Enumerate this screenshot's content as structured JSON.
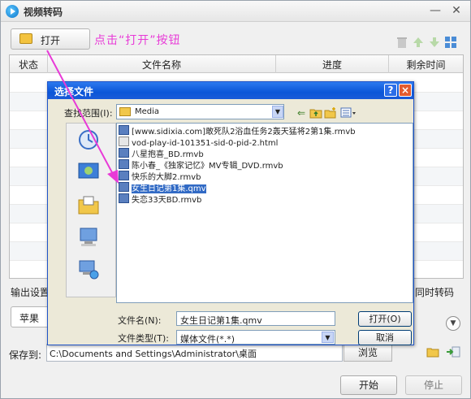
{
  "app": {
    "title": "视频转码"
  },
  "toolbar": {
    "open_label": "打开",
    "annotation": "点击“打开”按钮"
  },
  "table": {
    "columns": [
      "状态",
      "文件名称",
      "进度",
      "剩余时间"
    ],
    "rows": []
  },
  "output": {
    "settings_label": "输出设置",
    "concurrent_label": "同时转码",
    "preset_value": "苹果",
    "save_label": "保存到:",
    "save_path": "C:\\Documents and Settings\\Administrator\\桌面",
    "browse_label": "浏览"
  },
  "actions": {
    "start_label": "开始",
    "stop_label": "停止"
  },
  "dialog": {
    "title": "选择文件",
    "look_in_label": "查找范围(I):",
    "look_in_value": "Media",
    "files": [
      "[www.sidixia.com]敢死队2浴血任务2轰天猛将2第1集.rmvb",
      "vod-play-id-101351-sid-0-pid-2.html",
      "八星抱喜_BD.rmvb",
      "陈小春_《独家记忆》MV专辑_DVD.rmvb",
      "快乐的大脚2.rmvb",
      "女生日记第1集.qmv",
      "失恋33天BD.rmvb"
    ],
    "selected_file_index": 5,
    "filename_label": "文件名(N):",
    "filename_value": "女生日记第1集.qmv",
    "filetype_label": "文件类型(T):",
    "filetype_value": "媒体文件(*.*)",
    "open_label": "打开(O)",
    "cancel_label": "取消",
    "help_label": "?",
    "close_label": "×"
  },
  "colors": {
    "annotation": "#e83ad7",
    "dialog_title": "#0b56d8",
    "selection": "#316ac5"
  }
}
